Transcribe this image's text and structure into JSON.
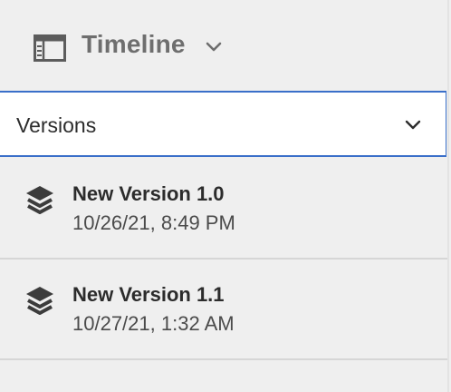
{
  "header": {
    "title": "Timeline",
    "rail_icon": "panel-rail-icon",
    "chevron_icon": "chevron-down-icon"
  },
  "filter": {
    "selected": "Versions",
    "chevron_icon": "chevron-down-icon"
  },
  "versions": [
    {
      "name": "New Version 1.0",
      "date": "10/26/21, 8:49 PM",
      "icon": "layers-icon"
    },
    {
      "name": "New Version 1.1",
      "date": "10/27/21, 1:32 AM",
      "icon": "layers-icon"
    }
  ],
  "colors": {
    "accent": "#3a6fc9",
    "panel_bg": "#efefef",
    "text_primary": "#2c2c2c",
    "text_muted": "#6e6e6e"
  }
}
